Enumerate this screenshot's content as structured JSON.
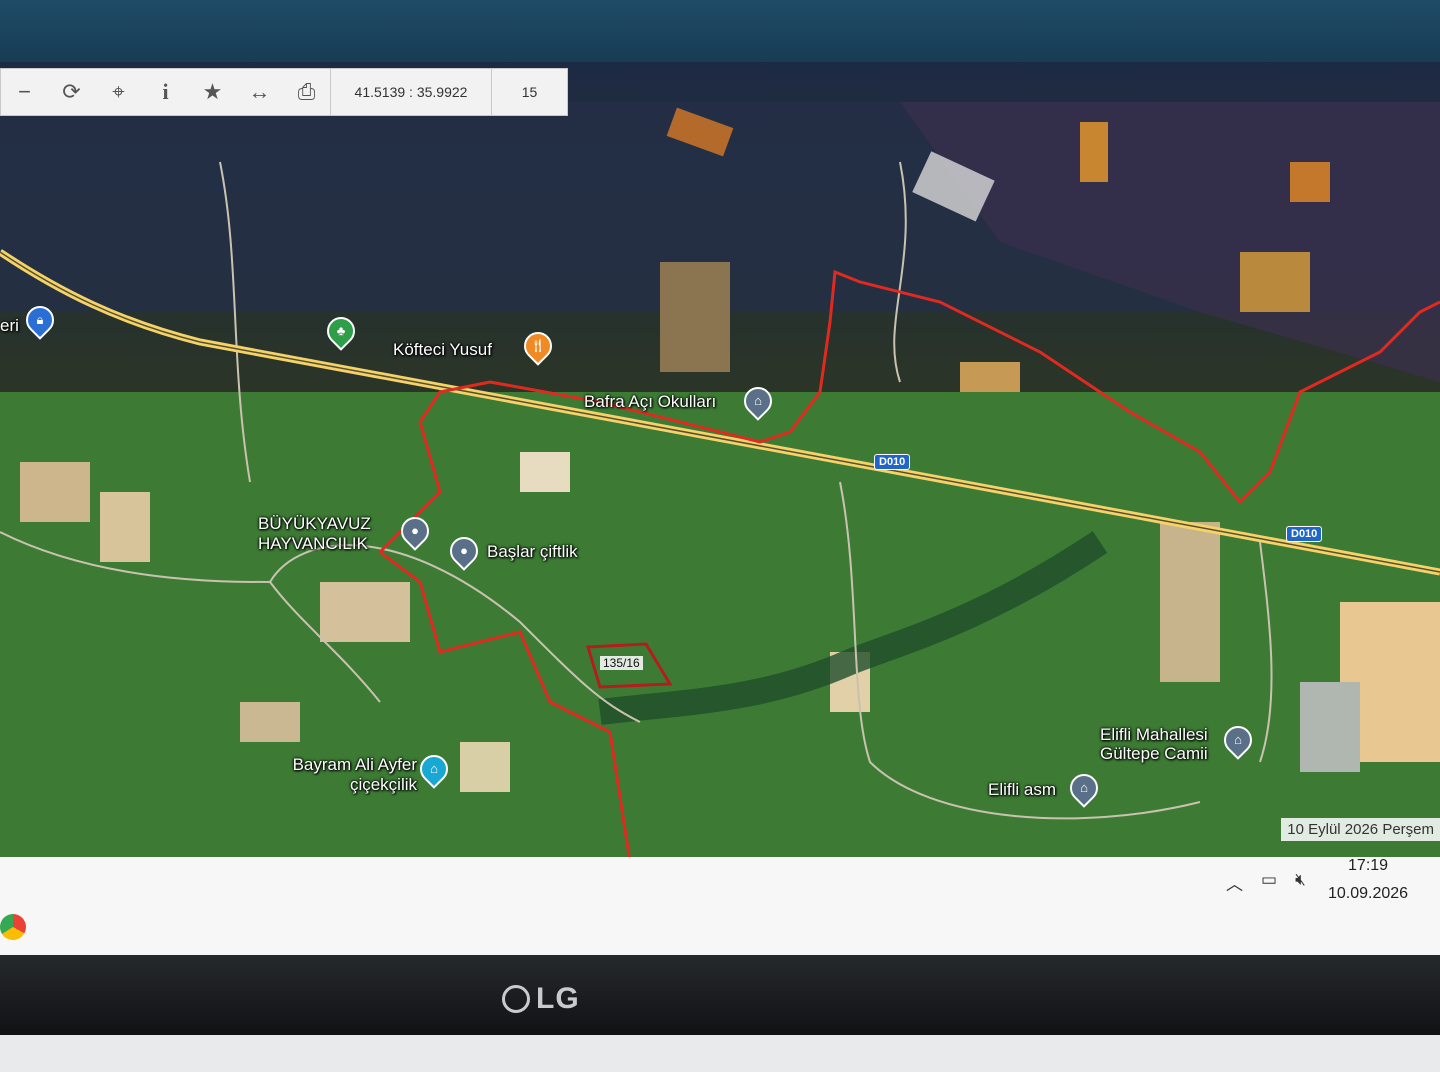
{
  "toolbar": {
    "coordinates": "41.5139 : 35.9922",
    "zoom_level": "15",
    "tools": [
      {
        "name": "zoom-out-icon",
        "glyph": "−"
      },
      {
        "name": "refresh-icon",
        "glyph": "⟳"
      },
      {
        "name": "locate-icon",
        "glyph": "⌖"
      },
      {
        "name": "info-icon",
        "glyph": "i"
      },
      {
        "name": "favorite-icon",
        "glyph": "★"
      },
      {
        "name": "measure-icon",
        "glyph": "↔"
      },
      {
        "name": "print-icon",
        "glyph": "⎙"
      }
    ]
  },
  "map": {
    "pois": {
      "kofteci": "Köfteci Yusuf",
      "bafra": "Bafra Açı Okulları",
      "buyukyavuz": "BÜYÜKYAVUZ HAYVANCILIK",
      "baslar": "Başlar çiftlik",
      "bayram": "Bayram Ali Ayfer çiçekçilik",
      "elifli_mahallesi": "Elifli Mahallesi Gültepe Camii",
      "elifli_asm": "Elifli asm",
      "eri": "eri"
    },
    "road_shields": [
      "D010",
      "D010"
    ],
    "parcel_label": "135/16"
  },
  "date_banner": "10 Eylül 2026 Perşem",
  "taskbar": {
    "time": "17:19",
    "date": "10.09.2026",
    "tray_icons": [
      "chevron-up-icon",
      "network-icon",
      "volume-muted-icon"
    ]
  },
  "monitor": {
    "brand": "LG"
  },
  "colors": {
    "boundary": "#e02a20",
    "road": "#f4d36a",
    "shield": "#1e66c8"
  }
}
